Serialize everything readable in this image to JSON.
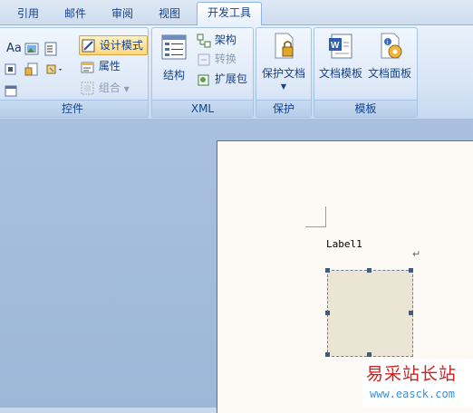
{
  "tabs": [
    {
      "label": "引用"
    },
    {
      "label": "邮件"
    },
    {
      "label": "审阅"
    },
    {
      "label": "视图"
    },
    {
      "label": "开发工具"
    }
  ],
  "ribbon": {
    "controls": {
      "label": "控件",
      "aa_label": "Aa",
      "design_mode": "设计模式",
      "properties": "属性",
      "group": "组合"
    },
    "xml": {
      "label": "XML",
      "structure": "结构",
      "schema": "架构",
      "transform": "转换",
      "expansion_pack": "扩展包"
    },
    "protect": {
      "label": "保护",
      "protect_document": "保护文档"
    },
    "templates": {
      "label": "模板",
      "document_template": "文档模板",
      "document_panel": "文档面板"
    }
  },
  "document": {
    "label_text": "Label1",
    "para_mark": "↵"
  },
  "watermark": {
    "title": "易采站长站",
    "url": "www.easck.com"
  },
  "colors": {
    "accent": "#15428b",
    "selected": "#ffd77a",
    "watermark_red": "#d21f1f",
    "watermark_blue": "#3a8fd6"
  }
}
